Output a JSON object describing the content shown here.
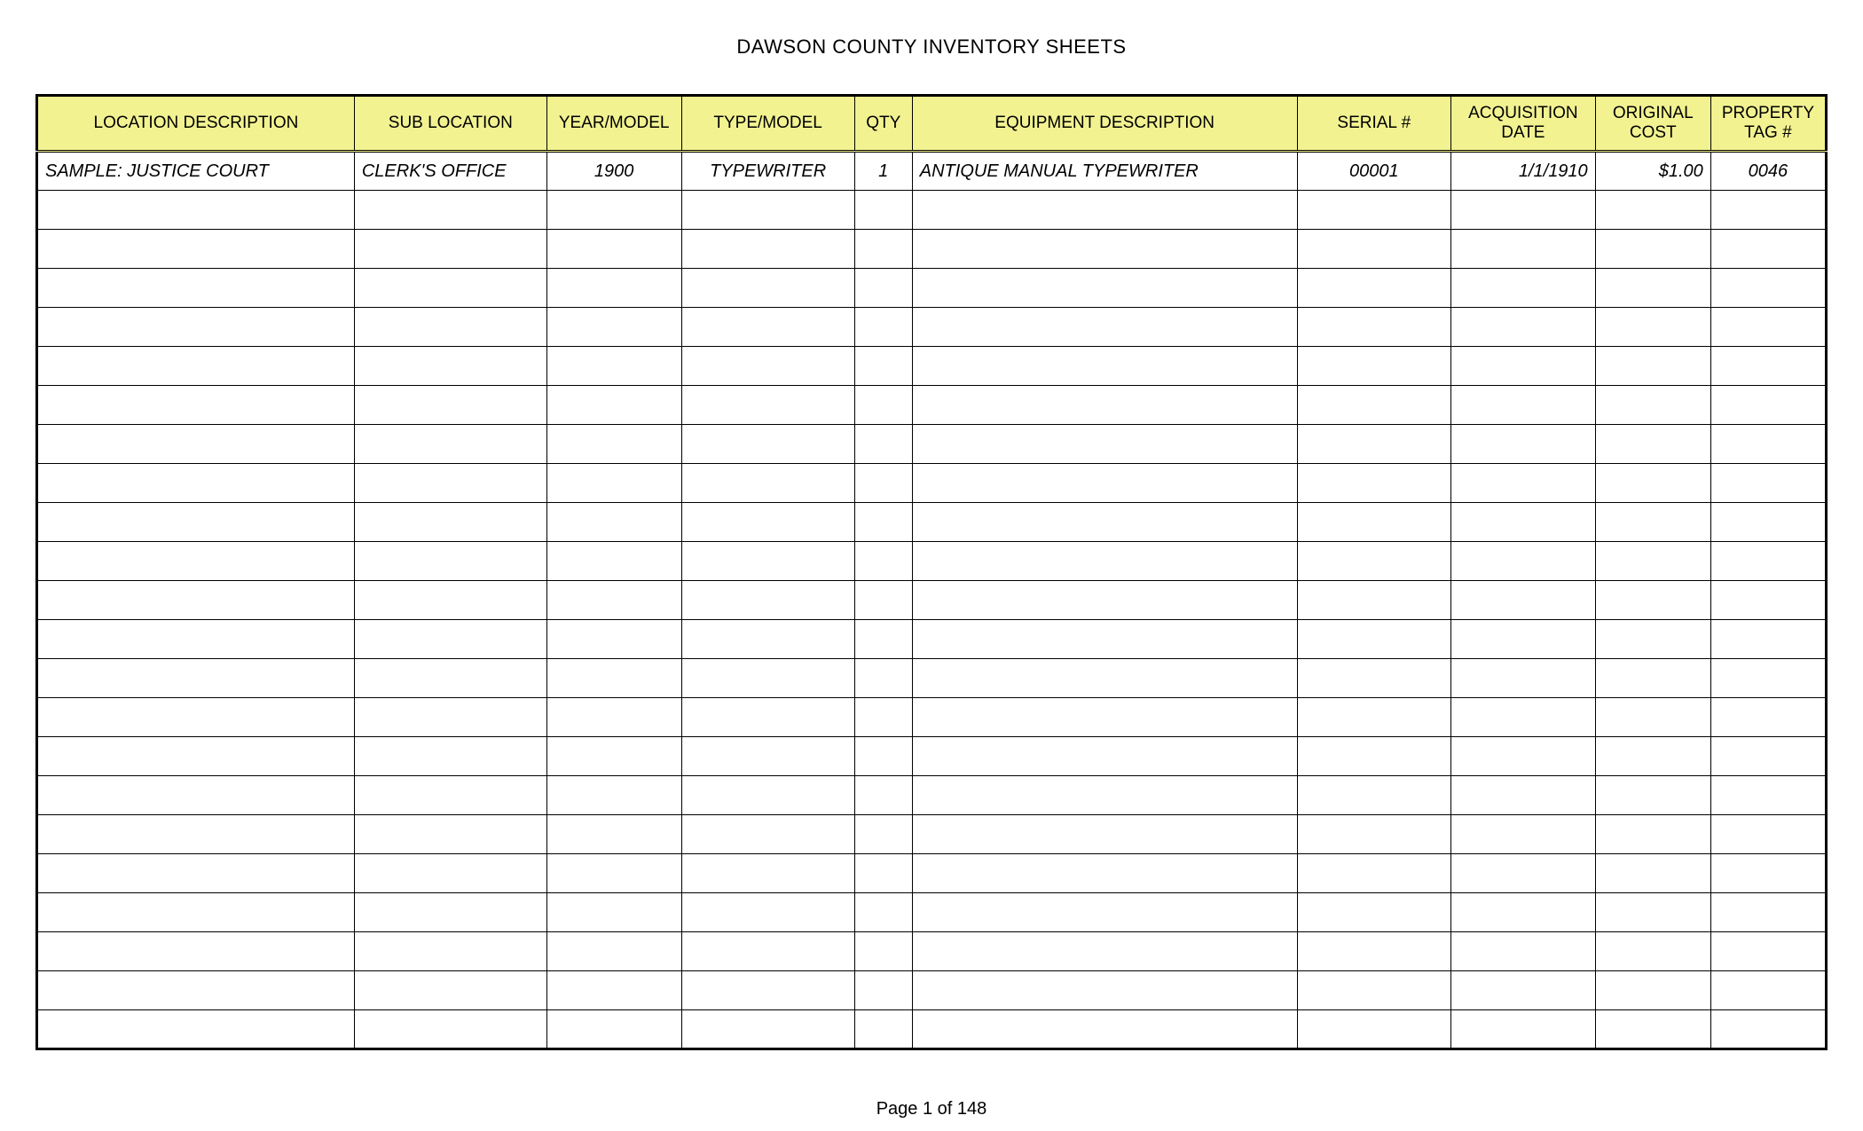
{
  "title": "DAWSON COUNTY INVENTORY SHEETS",
  "columns": [
    "LOCATION DESCRIPTION",
    "SUB LOCATION",
    "YEAR/MODEL",
    "TYPE/MODEL",
    "QTY",
    "EQUIPMENT DESCRIPTION",
    "SERIAL #",
    "ACQUISITION DATE",
    "ORIGINAL COST",
    "PROPERTY TAG #"
  ],
  "rows": [
    {
      "location": "SAMPLE: JUSTICE COURT",
      "sublocation": "CLERK'S OFFICE",
      "yearmodel": "1900",
      "typemodel": "TYPEWRITER",
      "qty": "1",
      "equipdesc": "ANTIQUE MANUAL TYPEWRITER",
      "serial": "00001",
      "acqdate": "1/1/1910",
      "origcost": "$1.00",
      "proptag": "0046"
    }
  ],
  "empty_row_count": 22,
  "footer": "Page 1 of 148"
}
